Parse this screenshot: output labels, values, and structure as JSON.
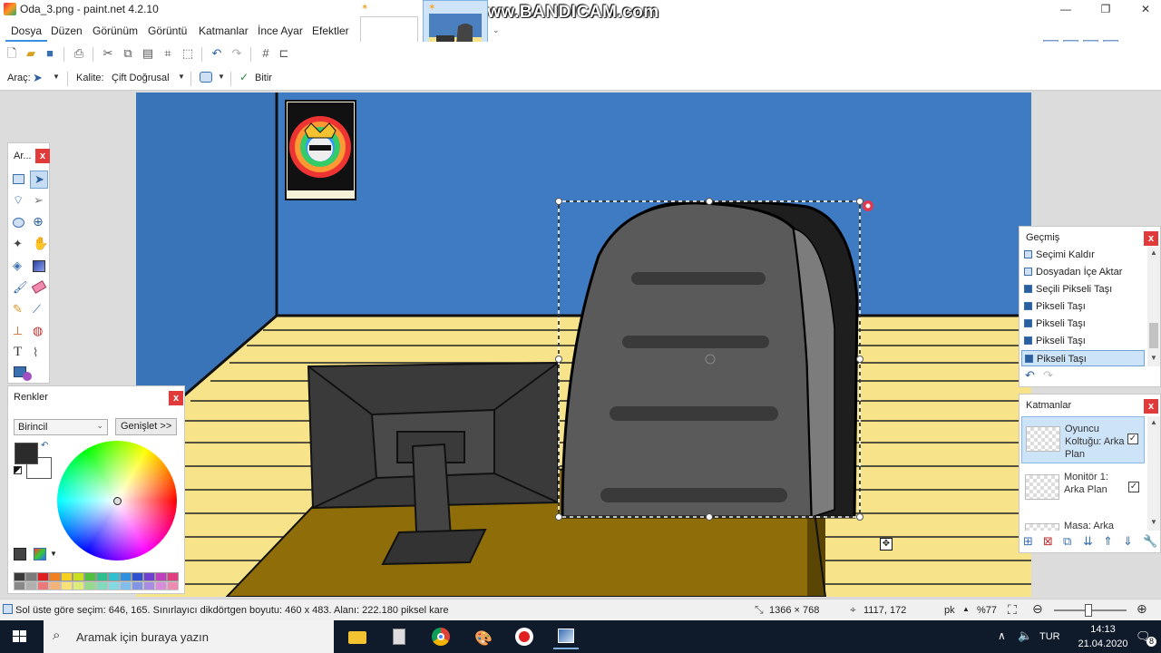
{
  "window": {
    "title": "Oda_3.png - paint.net 4.2.10",
    "watermark": "www.BANDICAM.com"
  },
  "menu": {
    "items": [
      "Dosya",
      "Düzen",
      "Görünüm",
      "Görüntü",
      "Katmanlar",
      "İnce Ayar",
      "Efektler"
    ]
  },
  "options_bar": {
    "tool_label": "Araç:",
    "quality_label": "Kalite:",
    "quality_value": "Çift Doğrusal",
    "finish_label": "Bitir"
  },
  "tools_panel": {
    "title": "Ar...",
    "close": "x"
  },
  "colors_panel": {
    "title": "Renkler",
    "close": "x",
    "mode": "Birincil",
    "expand_label": "Genişlet >>",
    "primary_color": "#2b2b2b",
    "secondary_color": "#ffffff",
    "palette": [
      "#3a3a3a",
      "#7b7b7b",
      "#e02020",
      "#f08020",
      "#f8d020",
      "#c8e020",
      "#50c040",
      "#30c090",
      "#30c0d0",
      "#3090e0",
      "#3050d0",
      "#7040d0",
      "#c040c0",
      "#e04080"
    ]
  },
  "history_panel": {
    "title": "Geçmiş",
    "close": "x",
    "items": [
      "Seçimi Kaldır",
      "Dosyadan İçe Aktar",
      "Seçili Pikseli Taşı",
      "Pikseli Taşı",
      "Pikseli Taşı",
      "Pikseli Taşı",
      "Pikseli Taşı"
    ]
  },
  "layers_panel": {
    "title": "Katmanlar",
    "close": "x",
    "layers": [
      {
        "name": "Oyuncu Koltuğu: Arka Plan",
        "visible": true
      },
      {
        "name": "Monitör 1: Arka Plan",
        "visible": true
      },
      {
        "name": "Masa: Arka Plan",
        "visible": true
      }
    ]
  },
  "status": {
    "selection_info": "Sol üste göre seçim: 646, 165. Sınırlayıcı dikdörtgen boyutu: 460 x 483. Alanı: 222.180 piksel kare",
    "image_size": "1366 × 768",
    "cursor_pos": "1117, 172",
    "unit": "pk",
    "zoom": "%77"
  },
  "taskbar": {
    "search_placeholder": "Aramak için buraya yazın",
    "language": "TUR",
    "time": "14:13",
    "date": "21.04.2020",
    "notifications": "8"
  },
  "colors": {
    "accent": "#3c8ee0",
    "wall": "#4a7fc0",
    "floor": "#f7e38a",
    "desk": "#8f6e0a",
    "close_red": "#e03a3a"
  }
}
